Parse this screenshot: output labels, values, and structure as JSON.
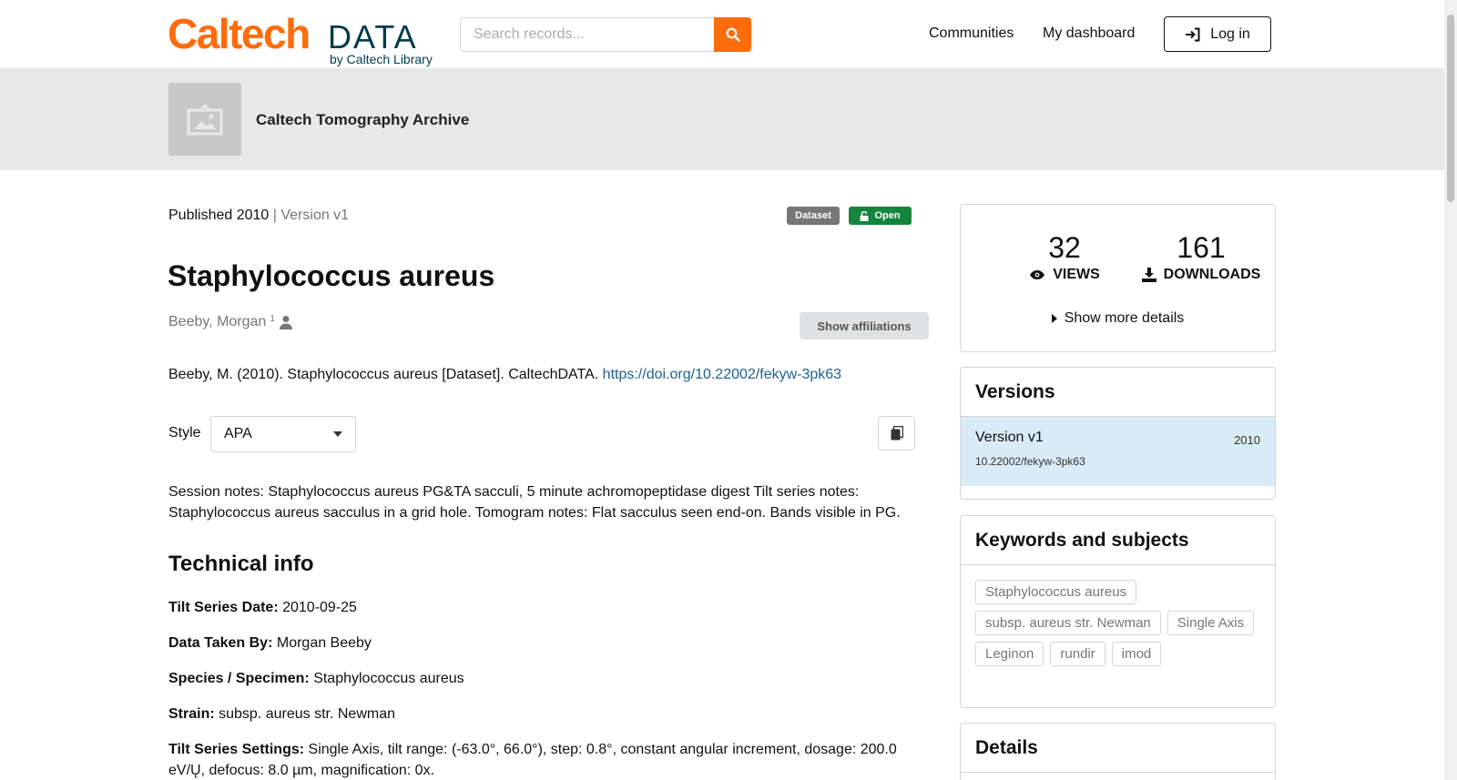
{
  "header": {
    "logo_main": "Caltech",
    "logo_data": "DATA",
    "logo_sub": "by Caltech Library",
    "search_placeholder": "Search records...",
    "nav": [
      "Communities",
      "My dashboard"
    ],
    "login": "Log in"
  },
  "banner": {
    "community": "Caltech Tomography Archive"
  },
  "record": {
    "published": "Published 2010",
    "version": "| Version v1",
    "badge_type": "Dataset",
    "badge_access": "Open",
    "title": "Staphylococcus aureus",
    "creator": "Beeby, Morgan",
    "creator_sup": "1",
    "show_affiliations": "Show affiliations",
    "citation_text": "Beeby, M. (2010). Staphylococcus aureus [Dataset]. CaltechDATA.",
    "citation_link": "https://doi.org/10.22002/fekyw-3pk63",
    "style_label": "Style",
    "style_value": "APA",
    "description": "Session notes: Staphylococcus aureus PG&TA sacculi, 5 minute achromopeptidase digest Tilt series notes: Staphylococcus aureus sacculus in a grid hole. Tomogram notes: Flat sacculus seen end-on. Bands visible in PG.",
    "tech_title": "Technical info",
    "tech": [
      {
        "label": "Tilt Series Date:",
        "value": "2010-09-25"
      },
      {
        "label": "Data Taken By:",
        "value": "Morgan Beeby"
      },
      {
        "label": "Species / Specimen:",
        "value": "Staphylococcus aureus"
      },
      {
        "label": "Strain:",
        "value": "subsp. aureus str. Newman"
      },
      {
        "label": "Tilt Series Settings:",
        "value": "Single Axis, tilt range: (-63.0°, 66.0°), step: 0.8°, constant angular increment, dosage: 200.0 eV/Ų, defocus: 8.0 µm, magnification: 0x."
      }
    ]
  },
  "sidebar": {
    "views_count": "32",
    "views_label": "VIEWS",
    "downloads_count": "161",
    "downloads_label": "DOWNLOADS",
    "more_details": "Show more details",
    "versions_title": "Versions",
    "version_name": "Version v1",
    "version_year": "2010",
    "version_doi": "10.22002/fekyw-3pk63",
    "keywords_title": "Keywords and subjects",
    "keywords": [
      "Staphylococcus aureus",
      "subsp. aureus str. Newman",
      "Single Axis",
      "Leginon",
      "rundir",
      "imod"
    ],
    "details_title": "Details"
  },
  "colors": {
    "brand_orange": "#ff6c0c",
    "brand_navy": "#003b4c",
    "link": "#1f5f8b",
    "open_green": "#16853c",
    "version_highlight": "#d9ebf6"
  }
}
